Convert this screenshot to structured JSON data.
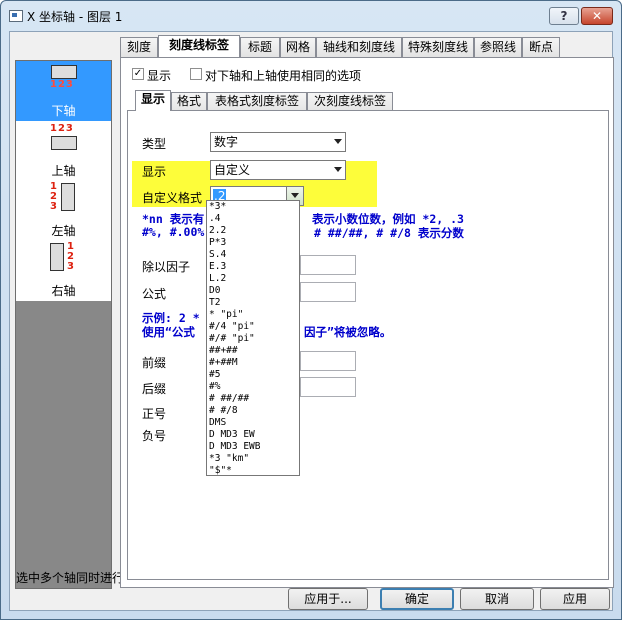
{
  "window": {
    "title": "X 坐标轴 - 图层 1",
    "help_label": "?",
    "close_label": "✕"
  },
  "top_tabs": [
    "刻度",
    "刻度线标签",
    "标题",
    "网格",
    "轴线和刻度线",
    "特殊刻度线",
    "参照线",
    "断点"
  ],
  "axes": [
    {
      "label": "下轴",
      "nums": "123"
    },
    {
      "label": "上轴",
      "nums": "123"
    },
    {
      "label": "左轴",
      "nums": "123"
    },
    {
      "label": "右轴",
      "nums": "123"
    }
  ],
  "status_text": "选中多个轴同时进行修改",
  "options": {
    "show_label": "显示",
    "show_checked": "✓",
    "same_option_label": "对下轴和上轴使用相同的选项"
  },
  "sub_tabs": [
    "显示",
    "格式",
    "表格式刻度标签",
    "次刻度线标签"
  ],
  "form": {
    "type_label": "类型",
    "type_value": "数字",
    "display_label": "显示",
    "display_value": "自定义",
    "custom_format_label": "自定义格式",
    "custom_format_value": ".2",
    "help_line1a": "*nn 表示有",
    "help_line1b": "表示小数位数，例如 *2, .3",
    "help_line2a": "#%, #.00%",
    "help_line2b": "# ##/##, # #/8 表示分数",
    "divide_label": "除以因子",
    "formula_label": "公式",
    "example_line1": "示例: 2 *",
    "example_line2a": "使用“公式",
    "example_line2b": "因子”将被忽略。",
    "prefix_label": "前缀",
    "suffix_label": "后缀",
    "positive_label": "正号",
    "negative_label": "负号"
  },
  "dropdown_items": [
    "*3*",
    ".4",
    "2.2",
    "P*3",
    "S.4",
    "E.3",
    "L.2",
    "D0",
    "T2",
    "* \"pi\"",
    "#/4 \"pi\"",
    "#/# \"pi\"",
    "##+##",
    "#+##M",
    "#5",
    "#%",
    "# ##/##",
    "# #/8",
    "DMS",
    "D MD3 EW",
    "D MD3 EWB",
    "*3 \"km\"",
    "\"$\"*"
  ],
  "buttons": {
    "apply_to": "应用于...",
    "ok": "确定",
    "cancel": "取消",
    "apply": "应用"
  },
  "colors": {
    "highlight": "#fdfd3a",
    "selected": "#3399ff",
    "help_text": "#0000cc",
    "axis_numbers": "#dd2211"
  }
}
